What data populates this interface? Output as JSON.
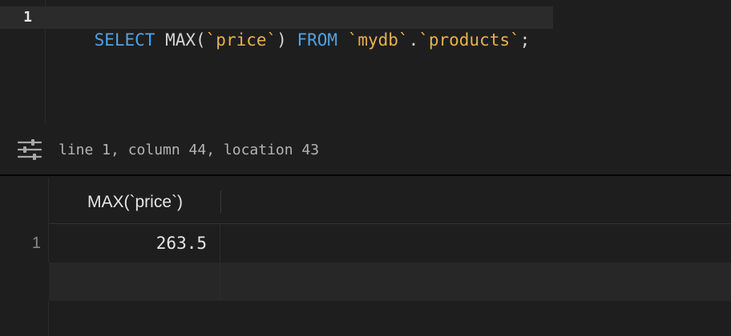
{
  "editor": {
    "line_number": "1",
    "tokens": [
      {
        "text": "SELECT",
        "kind": "kw"
      },
      {
        "text": " MAX(",
        "kind": "plain"
      },
      {
        "text": "`price`",
        "kind": "str"
      },
      {
        "text": ") ",
        "kind": "plain"
      },
      {
        "text": "FROM",
        "kind": "kw"
      },
      {
        "text": " ",
        "kind": "plain"
      },
      {
        "text": "`mydb`",
        "kind": "str"
      },
      {
        "text": ".",
        "kind": "plain"
      },
      {
        "text": "`products`",
        "kind": "str"
      },
      {
        "text": ";",
        "kind": "plain"
      }
    ]
  },
  "statusbar": {
    "icon": "sliders-icon",
    "cursor_text": "line 1, column 44, location 43"
  },
  "results": {
    "columns": [
      "MAX(`price`)"
    ],
    "rows": [
      {
        "num": "1",
        "value": "263.5"
      }
    ]
  },
  "colors": {
    "keyword": "#4ea3e6",
    "string": "#e8b24a",
    "background": "#1e1e1e"
  }
}
